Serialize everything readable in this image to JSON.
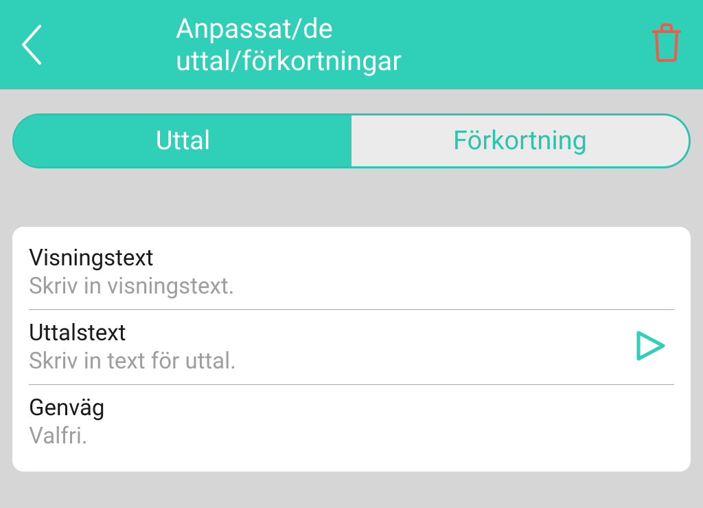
{
  "header": {
    "title": "Anpassat/de uttal/förkortningar"
  },
  "tabs": {
    "pronunciation": "Uttal",
    "abbreviation": "Förkortning"
  },
  "fields": {
    "displayText": {
      "label": "Visningstext",
      "placeholder": "Skriv in visningstext."
    },
    "pronunciationText": {
      "label": "Uttalstext",
      "placeholder": "Skriv in text för uttal."
    },
    "shortcut": {
      "label": "Genväg",
      "placeholder": "Valfri."
    }
  }
}
